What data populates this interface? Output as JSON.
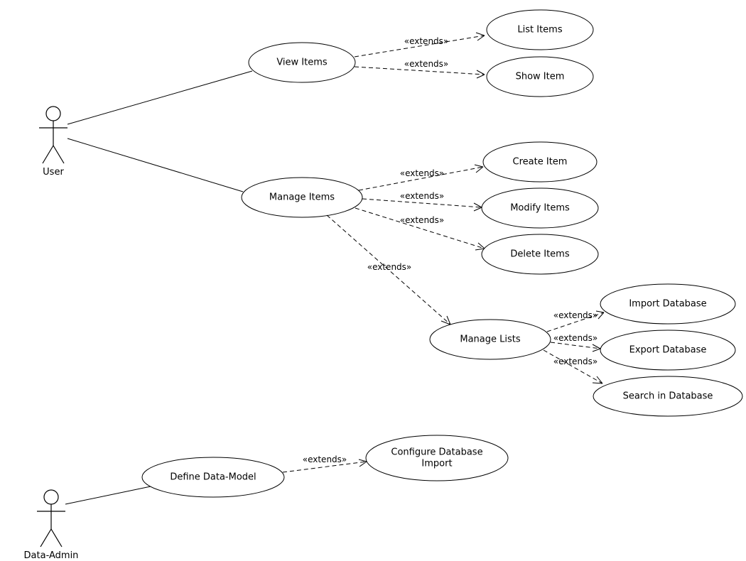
{
  "actors": {
    "user": {
      "label": "User"
    },
    "dataAdmin": {
      "label": "Data-Admin"
    }
  },
  "usecases": {
    "viewItems": "View Items",
    "listItems": "List Items",
    "showItem": "Show Item",
    "manageItems": "Manage Items",
    "createItem": "Create Item",
    "modifyItems": "Modify Items",
    "deleteItems": "Delete Items",
    "manageLists": "Manage Lists",
    "importDatabase": "Import Database",
    "exportDatabase": "Export Database",
    "searchInDatabase": "Search in Database",
    "defineDataModel": "Define Data-Model",
    "configureDbImport1": "Configure Database",
    "configureDbImport2": "Import"
  },
  "rel": {
    "extends": "«extends»"
  }
}
